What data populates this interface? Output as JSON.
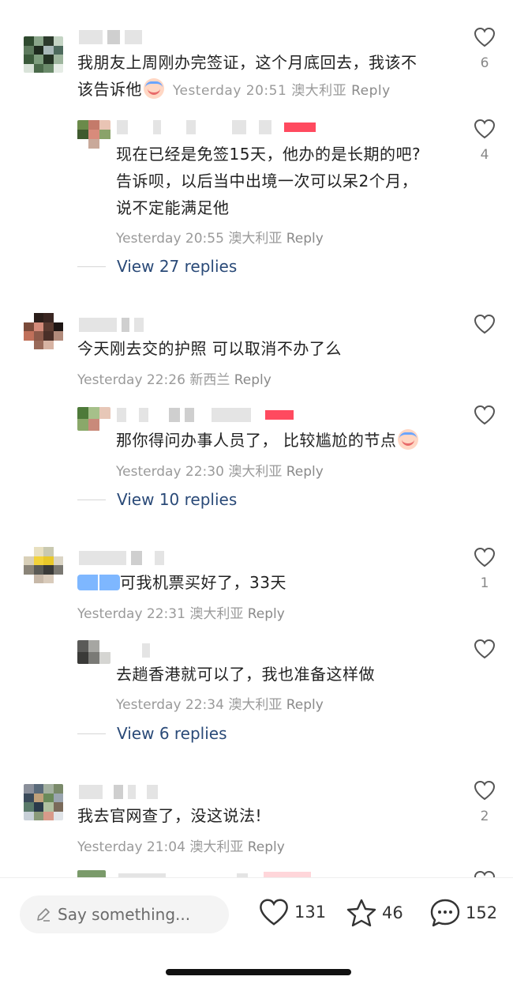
{
  "comments": [
    {
      "text_line1": "我朋友上周刚办完签证，这个月底回去，我该不",
      "text_line2": "该告诉他",
      "time": "Yesterday 20:51",
      "location": "澳大利亚",
      "reply_label": "Reply",
      "likes": "6",
      "reply": {
        "lines": [
          "现在已经是免签15天，他办的是长期的吧?",
          "告诉呗，以后当中出境一次可以呆2个月，",
          "说不定能满足他"
        ],
        "time": "Yesterday 20:55",
        "location": "澳大利亚",
        "reply_label": "Reply",
        "likes": "4"
      },
      "view_replies": "View 27 replies"
    },
    {
      "text_line1": "今天刚去交的护照 可以取消不办了么",
      "time": "Yesterday 22:26",
      "location": "新西兰",
      "reply_label": "Reply",
      "likes": "",
      "reply": {
        "lines": [
          "那你得问办事人员了， 比较尴尬的节点"
        ],
        "time": "Yesterday 22:30",
        "location": "澳大利亚",
        "reply_label": "Reply",
        "likes": ""
      },
      "view_replies": "View 10 replies"
    },
    {
      "text_line1": "可我机票买好了，33天",
      "time": "Yesterday 22:31",
      "location": "澳大利亚",
      "reply_label": "Reply",
      "likes": "1",
      "reply": {
        "lines": [
          "去趟香港就可以了，我也准备这样做"
        ],
        "time": "Yesterday 22:34",
        "location": "澳大利亚",
        "reply_label": "Reply",
        "likes": ""
      },
      "view_replies": "View 6 replies"
    },
    {
      "text_line1": "我去官网查了，没这说法!",
      "time": "Yesterday 21:04",
      "location": "澳大利亚",
      "reply_label": "Reply",
      "likes": "2"
    }
  ],
  "bottom_bar": {
    "placeholder": "Say something...",
    "likes": "131",
    "stars": "46",
    "comments": "152"
  },
  "colors": {
    "link": "#2a4a78",
    "meta": "#9a9a9a",
    "accent": "#ff4a5f"
  }
}
